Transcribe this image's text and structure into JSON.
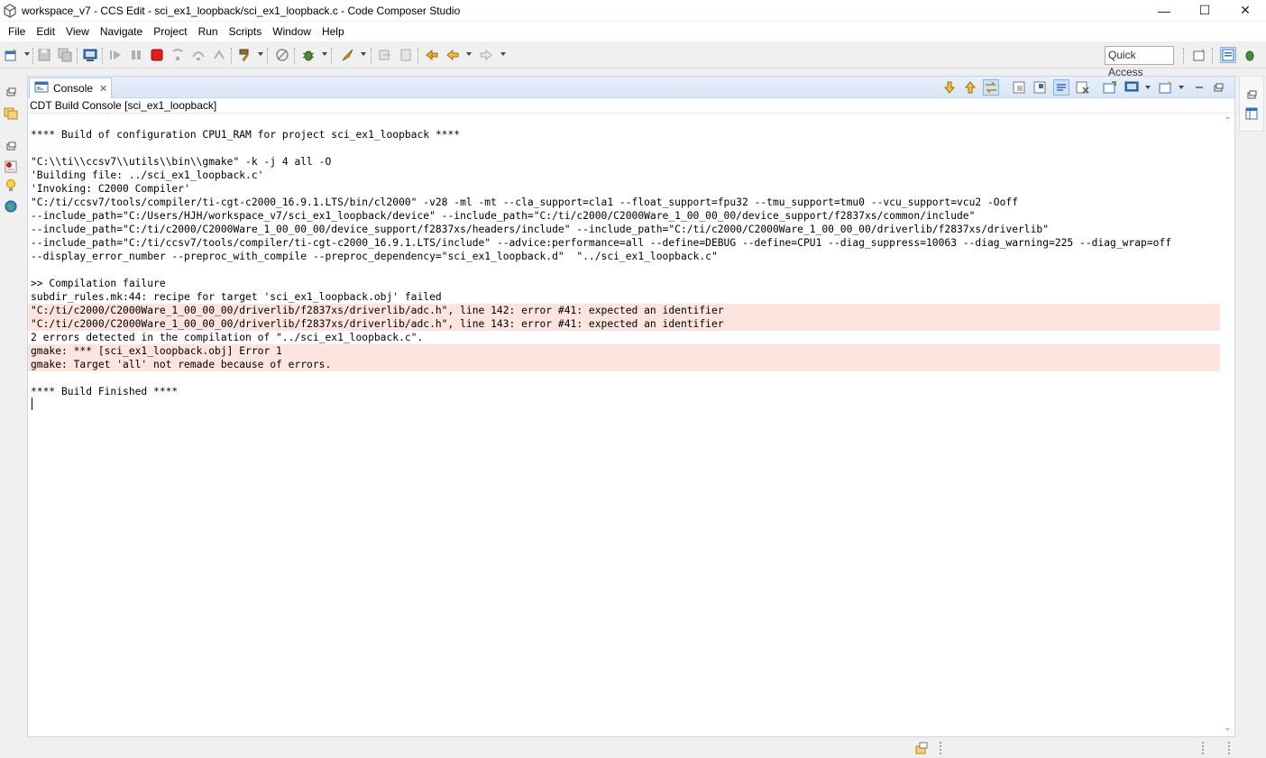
{
  "window": {
    "title": "workspace_v7 - CCS Edit - sci_ex1_loopback/sci_ex1_loopback.c - Code Composer Studio",
    "controls": {
      "minimize": "—",
      "maximize": "☐",
      "close": "✕"
    }
  },
  "menu": [
    "File",
    "Edit",
    "View",
    "Navigate",
    "Project",
    "Run",
    "Scripts",
    "Window",
    "Help"
  ],
  "toolbar": {
    "quick_access": "Quick Access"
  },
  "console": {
    "tab_label": "Console",
    "tab_close": "✕",
    "console_name": "CDT Build Console [sci_ex1_loopback]",
    "lines": [
      {
        "text": "",
        "error": false
      },
      {
        "text": "**** Build of configuration CPU1_RAM for project sci_ex1_loopback ****",
        "error": false
      },
      {
        "text": "",
        "error": false
      },
      {
        "text": "\"C:\\\\ti\\\\ccsv7\\\\utils\\\\bin\\\\gmake\" -k -j 4 all -O",
        "error": false
      },
      {
        "text": "'Building file: ../sci_ex1_loopback.c'",
        "error": false
      },
      {
        "text": "'Invoking: C2000 Compiler'",
        "error": false
      },
      {
        "text": "\"C:/ti/ccsv7/tools/compiler/ti-cgt-c2000_16.9.1.LTS/bin/cl2000\" -v28 -ml -mt --cla_support=cla1 --float_support=fpu32 --tmu_support=tmu0 --vcu_support=vcu2 -Ooff",
        "error": false
      },
      {
        "text": "--include_path=\"C:/Users/HJH/workspace_v7/sci_ex1_loopback/device\" --include_path=\"C:/ti/c2000/C2000Ware_1_00_00_00/device_support/f2837xs/common/include\"",
        "error": false
      },
      {
        "text": "--include_path=\"C:/ti/c2000/C2000Ware_1_00_00_00/device_support/f2837xs/headers/include\" --include_path=\"C:/ti/c2000/C2000Ware_1_00_00_00/driverlib/f2837xs/driverlib\"",
        "error": false
      },
      {
        "text": "--include_path=\"C:/ti/ccsv7/tools/compiler/ti-cgt-c2000_16.9.1.LTS/include\" --advice:performance=all --define=DEBUG --define=CPU1 --diag_suppress=10063 --diag_warning=225 --diag_wrap=off",
        "error": false
      },
      {
        "text": "--display_error_number --preproc_with_compile --preproc_dependency=\"sci_ex1_loopback.d\"  \"../sci_ex1_loopback.c\"",
        "error": false
      },
      {
        "text": "",
        "error": false
      },
      {
        "text": ">> Compilation failure",
        "error": false
      },
      {
        "text": "subdir_rules.mk:44: recipe for target 'sci_ex1_loopback.obj' failed",
        "error": false
      },
      {
        "text": "\"C:/ti/c2000/C2000Ware_1_00_00_00/driverlib/f2837xs/driverlib/adc.h\", line 142: error #41: expected an identifier",
        "error": true
      },
      {
        "text": "\"C:/ti/c2000/C2000Ware_1_00_00_00/driverlib/f2837xs/driverlib/adc.h\", line 143: error #41: expected an identifier",
        "error": true
      },
      {
        "text": "2 errors detected in the compilation of \"../sci_ex1_loopback.c\".",
        "error": false
      },
      {
        "text": "gmake: *** [sci_ex1_loopback.obj] Error 1",
        "error": true
      },
      {
        "text": "gmake: Target 'all' not remade because of errors.",
        "error": true
      },
      {
        "text": "",
        "error": false
      },
      {
        "text": "**** Build Finished ****",
        "error": false
      }
    ]
  },
  "colors": {
    "error_line_background": "#fde4df",
    "view_tab_border": "#c8d6e8",
    "terminate_red": "#e02020"
  },
  "icons": {
    "app": "ccs-app-icon",
    "console_tab": "console-icon"
  }
}
